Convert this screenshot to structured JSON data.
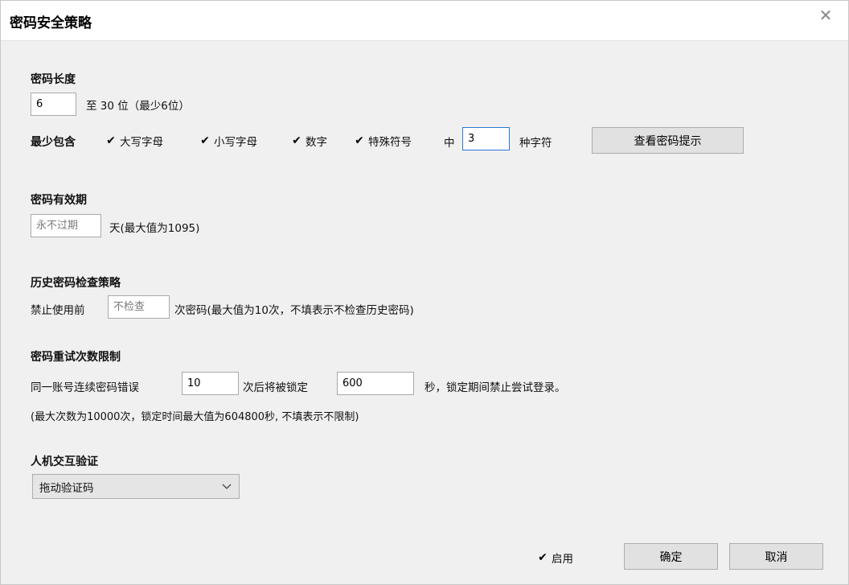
{
  "dialog": {
    "title": "密码安全策略",
    "close_symbol": "✕"
  },
  "password_length": {
    "heading": "密码长度",
    "min_value": "6",
    "range_text": "至 30 位（最少6位）"
  },
  "complexity": {
    "label": "最少包含",
    "options": [
      {
        "label": "大写字母",
        "checked": true
      },
      {
        "label": "小写字母",
        "checked": true
      },
      {
        "label": "数字",
        "checked": true
      },
      {
        "label": "特殊符号",
        "checked": true
      }
    ],
    "middle_text": "中",
    "count_value": "3",
    "suffix_text": "种字符",
    "hint_button": "查看密码提示"
  },
  "validity": {
    "heading": "密码有效期",
    "placeholder": "永不过期",
    "suffix_text": "天(最大值为1095)"
  },
  "history": {
    "heading": "历史密码检查策略",
    "prefix_text": "禁止使用前",
    "placeholder": "不检查",
    "suffix_text": "次密码(最大值为10次，不填表示不检查历史密码)"
  },
  "retry": {
    "heading": "密码重试次数限制",
    "prefix_text": "同一账号连续密码错误",
    "attempts_value": "10",
    "middle_text": "次后将被锁定",
    "lock_value": "600",
    "suffix_text": "秒，锁定期间禁止尝试登录。",
    "note": "(最大次数为10000次，锁定时间最大值为604800秒, 不填表示不限制)"
  },
  "captcha": {
    "heading": "人机交互验证",
    "selected": "拖动验证码"
  },
  "footer": {
    "enable_label": "启用",
    "enable_checked": true,
    "ok_button": "确定",
    "cancel_button": "取消"
  },
  "checkmark_symbol": "✔"
}
